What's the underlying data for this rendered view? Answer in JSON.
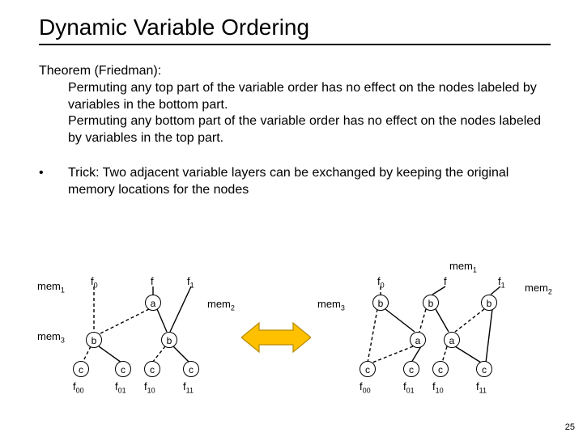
{
  "title": "Dynamic Variable Ordering",
  "theorem": {
    "head": "Theorem (Friedman):",
    "p1": "Permuting any top part of the variable order has no effect on the nodes labeled by variables in the bottom part.",
    "p2": "Permuting any bottom part of the variable order has no effect on the nodes labeled by variables in the top part."
  },
  "bullet": {
    "mark": "•",
    "text": "Trick: Two adjacent variable layers can be exchanged by keeping the original memory locations for the nodes"
  },
  "left": {
    "mem1": "mem",
    "mem1sub": "1",
    "mem2": "mem",
    "mem2sub": "2",
    "mem3": "mem",
    "mem3sub": "3",
    "f0": "f",
    "f0sub": "0",
    "f": "f",
    "f1": "f",
    "f1sub": "1",
    "a": "a",
    "b1": "b",
    "b2": "b",
    "c1": "c",
    "c2": "c",
    "c3": "c",
    "c4": "c",
    "r1": "f",
    "r1sub": "00",
    "r2": "f",
    "r2sub": "01",
    "r3": "f",
    "r3sub": "10",
    "r4": "f",
    "r4sub": "11"
  },
  "right": {
    "mem1": "mem",
    "mem1sub": "1",
    "mem2": "mem",
    "mem2sub": "2",
    "mem3": "mem",
    "mem3sub": "3",
    "f0": "f",
    "f0sub": "0",
    "f": "f",
    "f1": "f",
    "f1sub": "1",
    "b1": "b",
    "b2": "b",
    "b3": "b",
    "a1": "a",
    "a2": "a",
    "c1": "c",
    "c2": "c",
    "c3": "c",
    "c4": "c",
    "r1": "f",
    "r1sub": "00",
    "r2": "f",
    "r2sub": "01",
    "r3": "f",
    "r3sub": "10",
    "r4": "f",
    "r4sub": "11"
  },
  "pagenum": "25"
}
